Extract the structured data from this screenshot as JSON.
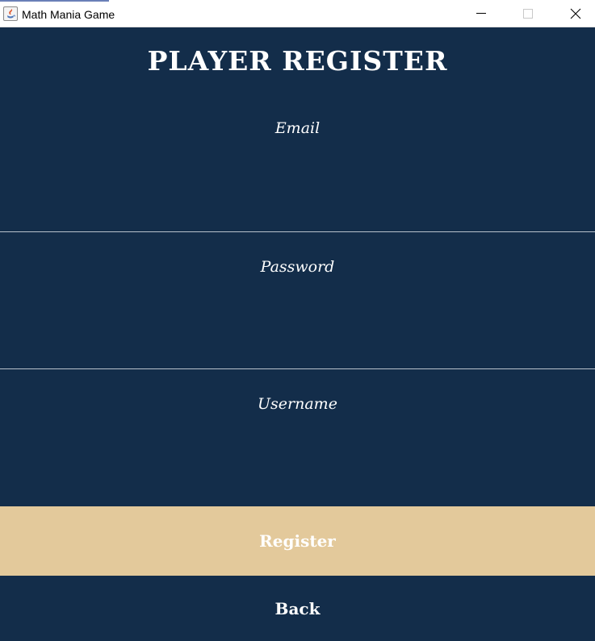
{
  "window": {
    "title": "Math Mania Game",
    "app_icon": "java-icon",
    "controls": [
      "minimize-icon",
      "maximize-icon",
      "close-icon"
    ]
  },
  "page": {
    "heading": "PLAYER REGISTER"
  },
  "form": {
    "email_label": "Email",
    "email_value": "",
    "password_label": "Password",
    "password_value": "",
    "username_label": "Username",
    "username_value": ""
  },
  "actions": {
    "register_label": "Register",
    "back_label": "Back"
  },
  "colors": {
    "background": "#132d4a",
    "register_button": "#e3c99b",
    "text": "#ffffff",
    "divider": "#b9c2cc"
  }
}
